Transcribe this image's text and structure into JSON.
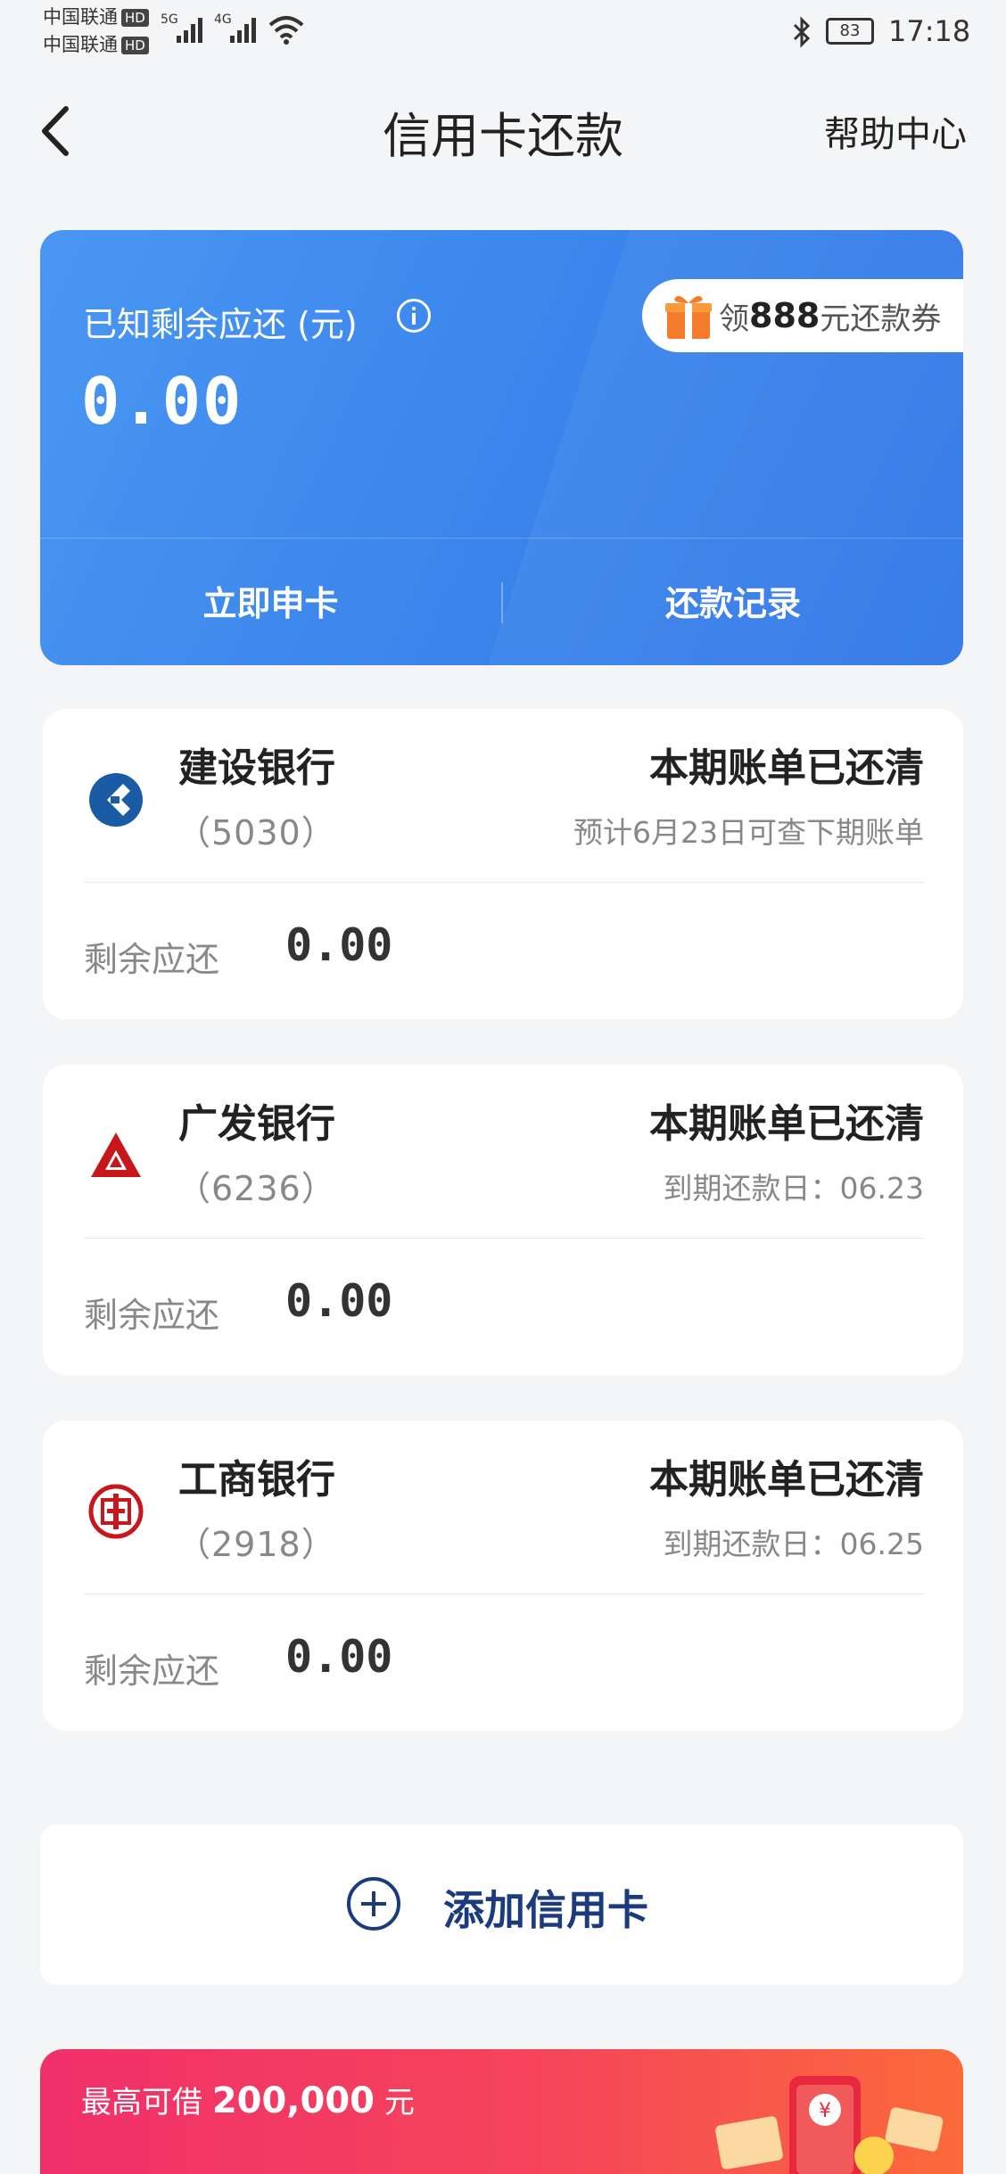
{
  "status_bar": {
    "carrier1": "中国联通",
    "carrier2": "中国联通",
    "hd": "HD",
    "net1": "5G",
    "net2": "4G",
    "battery": "83",
    "time": "17:18"
  },
  "header": {
    "title": "信用卡还款",
    "help": "帮助中心"
  },
  "summary": {
    "label": "已知剩余应还 (元)",
    "amount": "0.00",
    "coupon_prefix": "领",
    "coupon_amount": "888",
    "coupon_suffix": "元还款券",
    "apply_label": "立即申卡",
    "records_label": "还款记录"
  },
  "cards": [
    {
      "bank": "建设银行",
      "number": "（5030）",
      "status": "本期账单已还清",
      "sub": "预计6月23日可查下期账单",
      "remaining_label": "剩余应还",
      "remaining": "0.00",
      "logo_color": "#1a5ba6"
    },
    {
      "bank": "广发银行",
      "number": "（6236）",
      "status": "本期账单已还清",
      "sub": "到期还款日：06.23",
      "remaining_label": "剩余应还",
      "remaining": "0.00",
      "logo_color": "#c8161d"
    },
    {
      "bank": "工商银行",
      "number": "（2918）",
      "status": "本期账单已还清",
      "sub": "到期还款日：06.25",
      "remaining_label": "剩余应还",
      "remaining": "0.00",
      "logo_color": "#c8161d"
    }
  ],
  "add_card": {
    "label": "添加信用卡"
  },
  "loan": {
    "prefix": "最高可借",
    "amount": "200,000",
    "suffix": "元"
  }
}
